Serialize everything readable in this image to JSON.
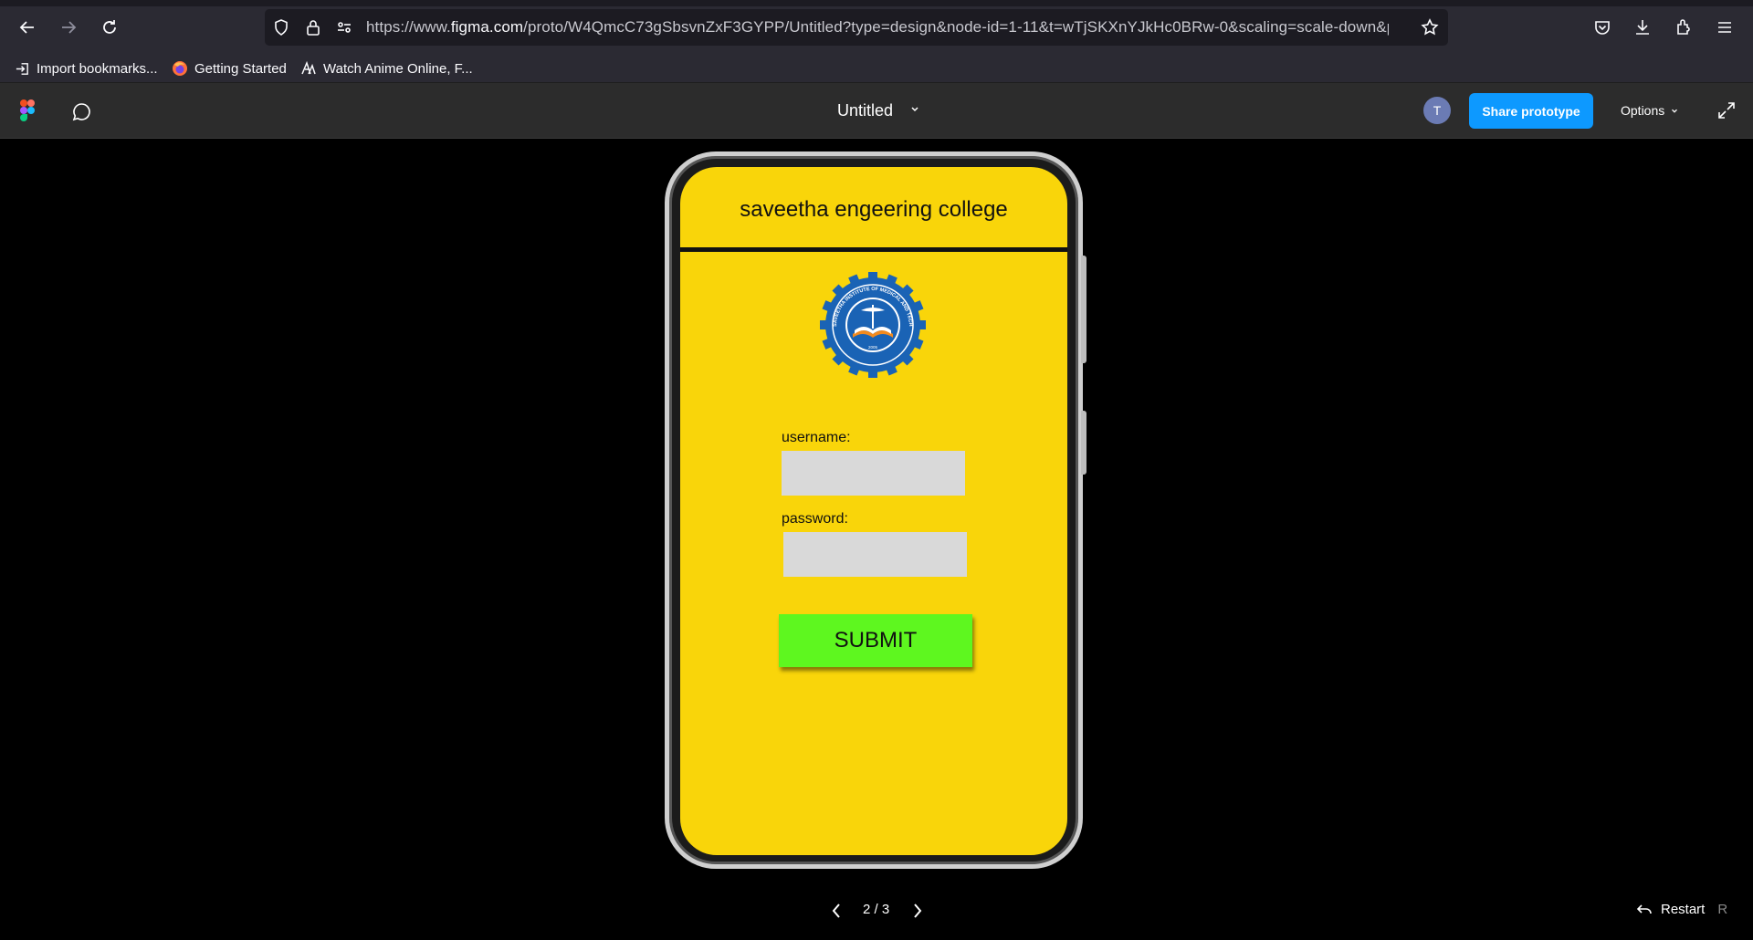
{
  "browser": {
    "url_prefix": "https://www.",
    "url_domain": "figma.com",
    "url_rest": "/proto/W4QmcC73gSbsvnZxF3GYPP/Untitled?type=design&node-id=1-11&t=wTjSKXnYJkHc0BRw-0&scaling=scale-down&pa",
    "bookmarks": [
      {
        "label": "Import bookmarks...",
        "icon": "import-icon"
      },
      {
        "label": "Getting Started",
        "icon": "firefox-icon"
      },
      {
        "label": "Watch Anime Online, F...",
        "icon": "anime-site-icon"
      }
    ]
  },
  "figma": {
    "file_title": "Untitled",
    "avatar_initial": "T",
    "share_label": "Share prototype",
    "options_label": "Options"
  },
  "prototype": {
    "header_title": "saveetha engeering college",
    "logo_text_top": "SAVEETHA INSTITUTE OF MEDICAL AND TECHNICAL SCIENCES",
    "logo_year": "2005",
    "username_label": "username:",
    "password_label": "password:",
    "username_value": "",
    "password_value": "",
    "submit_label": "SUBMIT"
  },
  "pager": {
    "page_text": "2 / 3",
    "restart_label": "Restart",
    "restart_key": "R"
  },
  "colors": {
    "screen_bg": "#f9d50a",
    "submit_bg": "#5ef71f",
    "share_btn": "#0d99ff",
    "field_bg": "#d9d9d9"
  }
}
